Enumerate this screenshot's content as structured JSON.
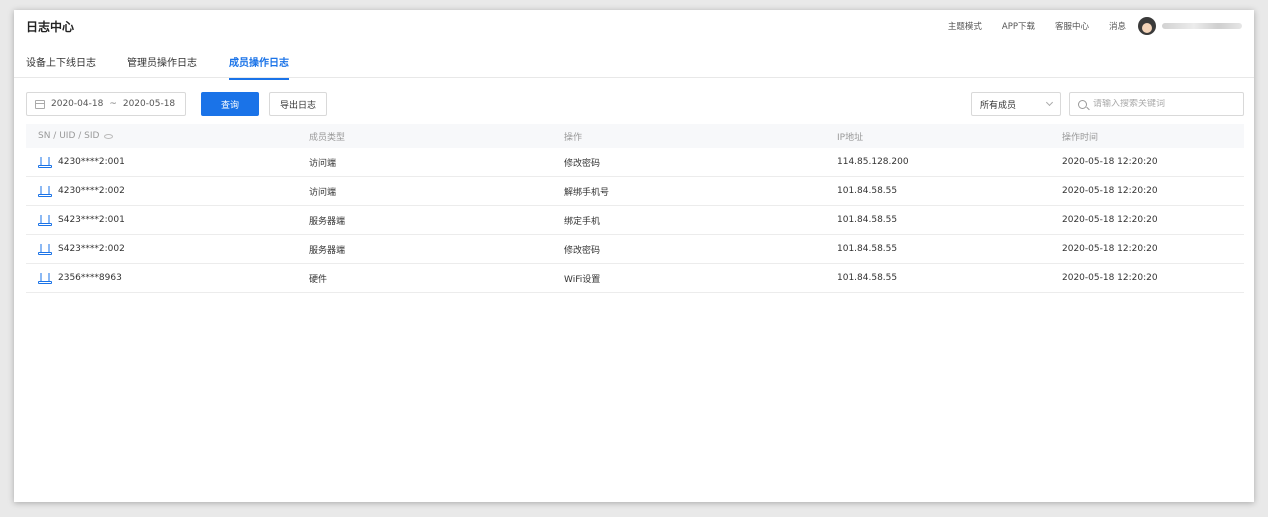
{
  "app": {
    "title": "日志中心"
  },
  "topnav": {
    "theme": "主题模式",
    "app_download": "APP下载",
    "service_center": "客服中心",
    "messages": "消息"
  },
  "tabs": [
    {
      "label": "设备上下线日志",
      "active": false
    },
    {
      "label": "管理员操作日志",
      "active": false
    },
    {
      "label": "成员操作日志",
      "active": true
    }
  ],
  "toolbar": {
    "date_start": "2020-04-18",
    "date_sep": "~",
    "date_end": "2020-05-18",
    "query_label": "查询",
    "export_label": "导出日志",
    "member_filter": "所有成员",
    "search_placeholder": "请输入搜索关键词"
  },
  "table": {
    "headers": [
      "SN / UID / SID",
      "成员类型",
      "操作",
      "IP地址",
      "操作时间"
    ],
    "rows": [
      {
        "id": "4230****2:001",
        "member_type": "访问端",
        "action": "修改密码",
        "ip": "114.85.128.200",
        "time": "2020-05-18 12:20:20"
      },
      {
        "id": "4230****2:002",
        "member_type": "访问端",
        "action": "解绑手机号",
        "ip": "101.84.58.55",
        "time": "2020-05-18 12:20:20"
      },
      {
        "id": "S423****2:001",
        "member_type": "服务器端",
        "action": "绑定手机",
        "ip": "101.84.58.55",
        "time": "2020-05-18 12:20:20"
      },
      {
        "id": "S423****2:002",
        "member_type": "服务器端",
        "action": "修改密码",
        "ip": "101.84.58.55",
        "time": "2020-05-18 12:20:20"
      },
      {
        "id": "2356****8963",
        "member_type": "硬件",
        "action": "WiFi设置",
        "ip": "101.84.58.55",
        "time": "2020-05-18 12:20:20"
      }
    ]
  },
  "colors": {
    "accent": "#1a73e8"
  }
}
